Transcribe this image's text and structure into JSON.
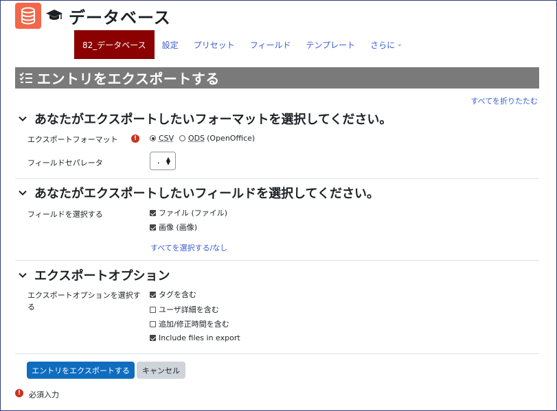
{
  "app": {
    "title": "データベース"
  },
  "nav": [
    {
      "label": "82_データベース",
      "active": true
    },
    {
      "label": "設定"
    },
    {
      "label": "プリセット"
    },
    {
      "label": "フィールド"
    },
    {
      "label": "テンプレート"
    },
    {
      "label": "さらに"
    }
  ],
  "page": {
    "title": "エントリをエクスポートする",
    "collapse_all": "すべてを折りたたむ"
  },
  "sections": {
    "format": {
      "heading": "あなたがエクスポートしたいフォーマットを選択してください。",
      "format_label": "エクスポートフォーマット",
      "options": [
        "CSV",
        "ODS",
        "(OpenOffice)"
      ],
      "selected": "CSV",
      "separator_label": "フィールドセパレータ",
      "separator_value": ","
    },
    "fields": {
      "heading": "あなたがエクスポートしたいフィールドを選択してください。",
      "label": "フィールドを選択する",
      "items": [
        {
          "label": "ファイル (ファイル)",
          "checked": true
        },
        {
          "label": "画像 (画像)",
          "checked": true
        }
      ],
      "select_all": "すべてを選択する/なし"
    },
    "options": {
      "heading": "エクスポートオプション",
      "label_line1": "エクスポートオプションを選択す",
      "label_line2": "る",
      "items": [
        {
          "label": "タグを含む",
          "checked": true
        },
        {
          "label": "ユーザ詳細を含む",
          "checked": false
        },
        {
          "label": "追加/修正時間を含む",
          "checked": false
        },
        {
          "label": "Include files in export",
          "checked": true
        }
      ]
    }
  },
  "buttons": {
    "submit": "エントリをエクスポートする",
    "cancel": "キャンセル"
  },
  "footer": {
    "required": "必須入力"
  },
  "colors": {
    "brand": "#f2674a",
    "active_tab": "#8b0000",
    "primary": "#0f6cbf",
    "title_bar": "#7a7a7a",
    "required": "#ca3120"
  }
}
